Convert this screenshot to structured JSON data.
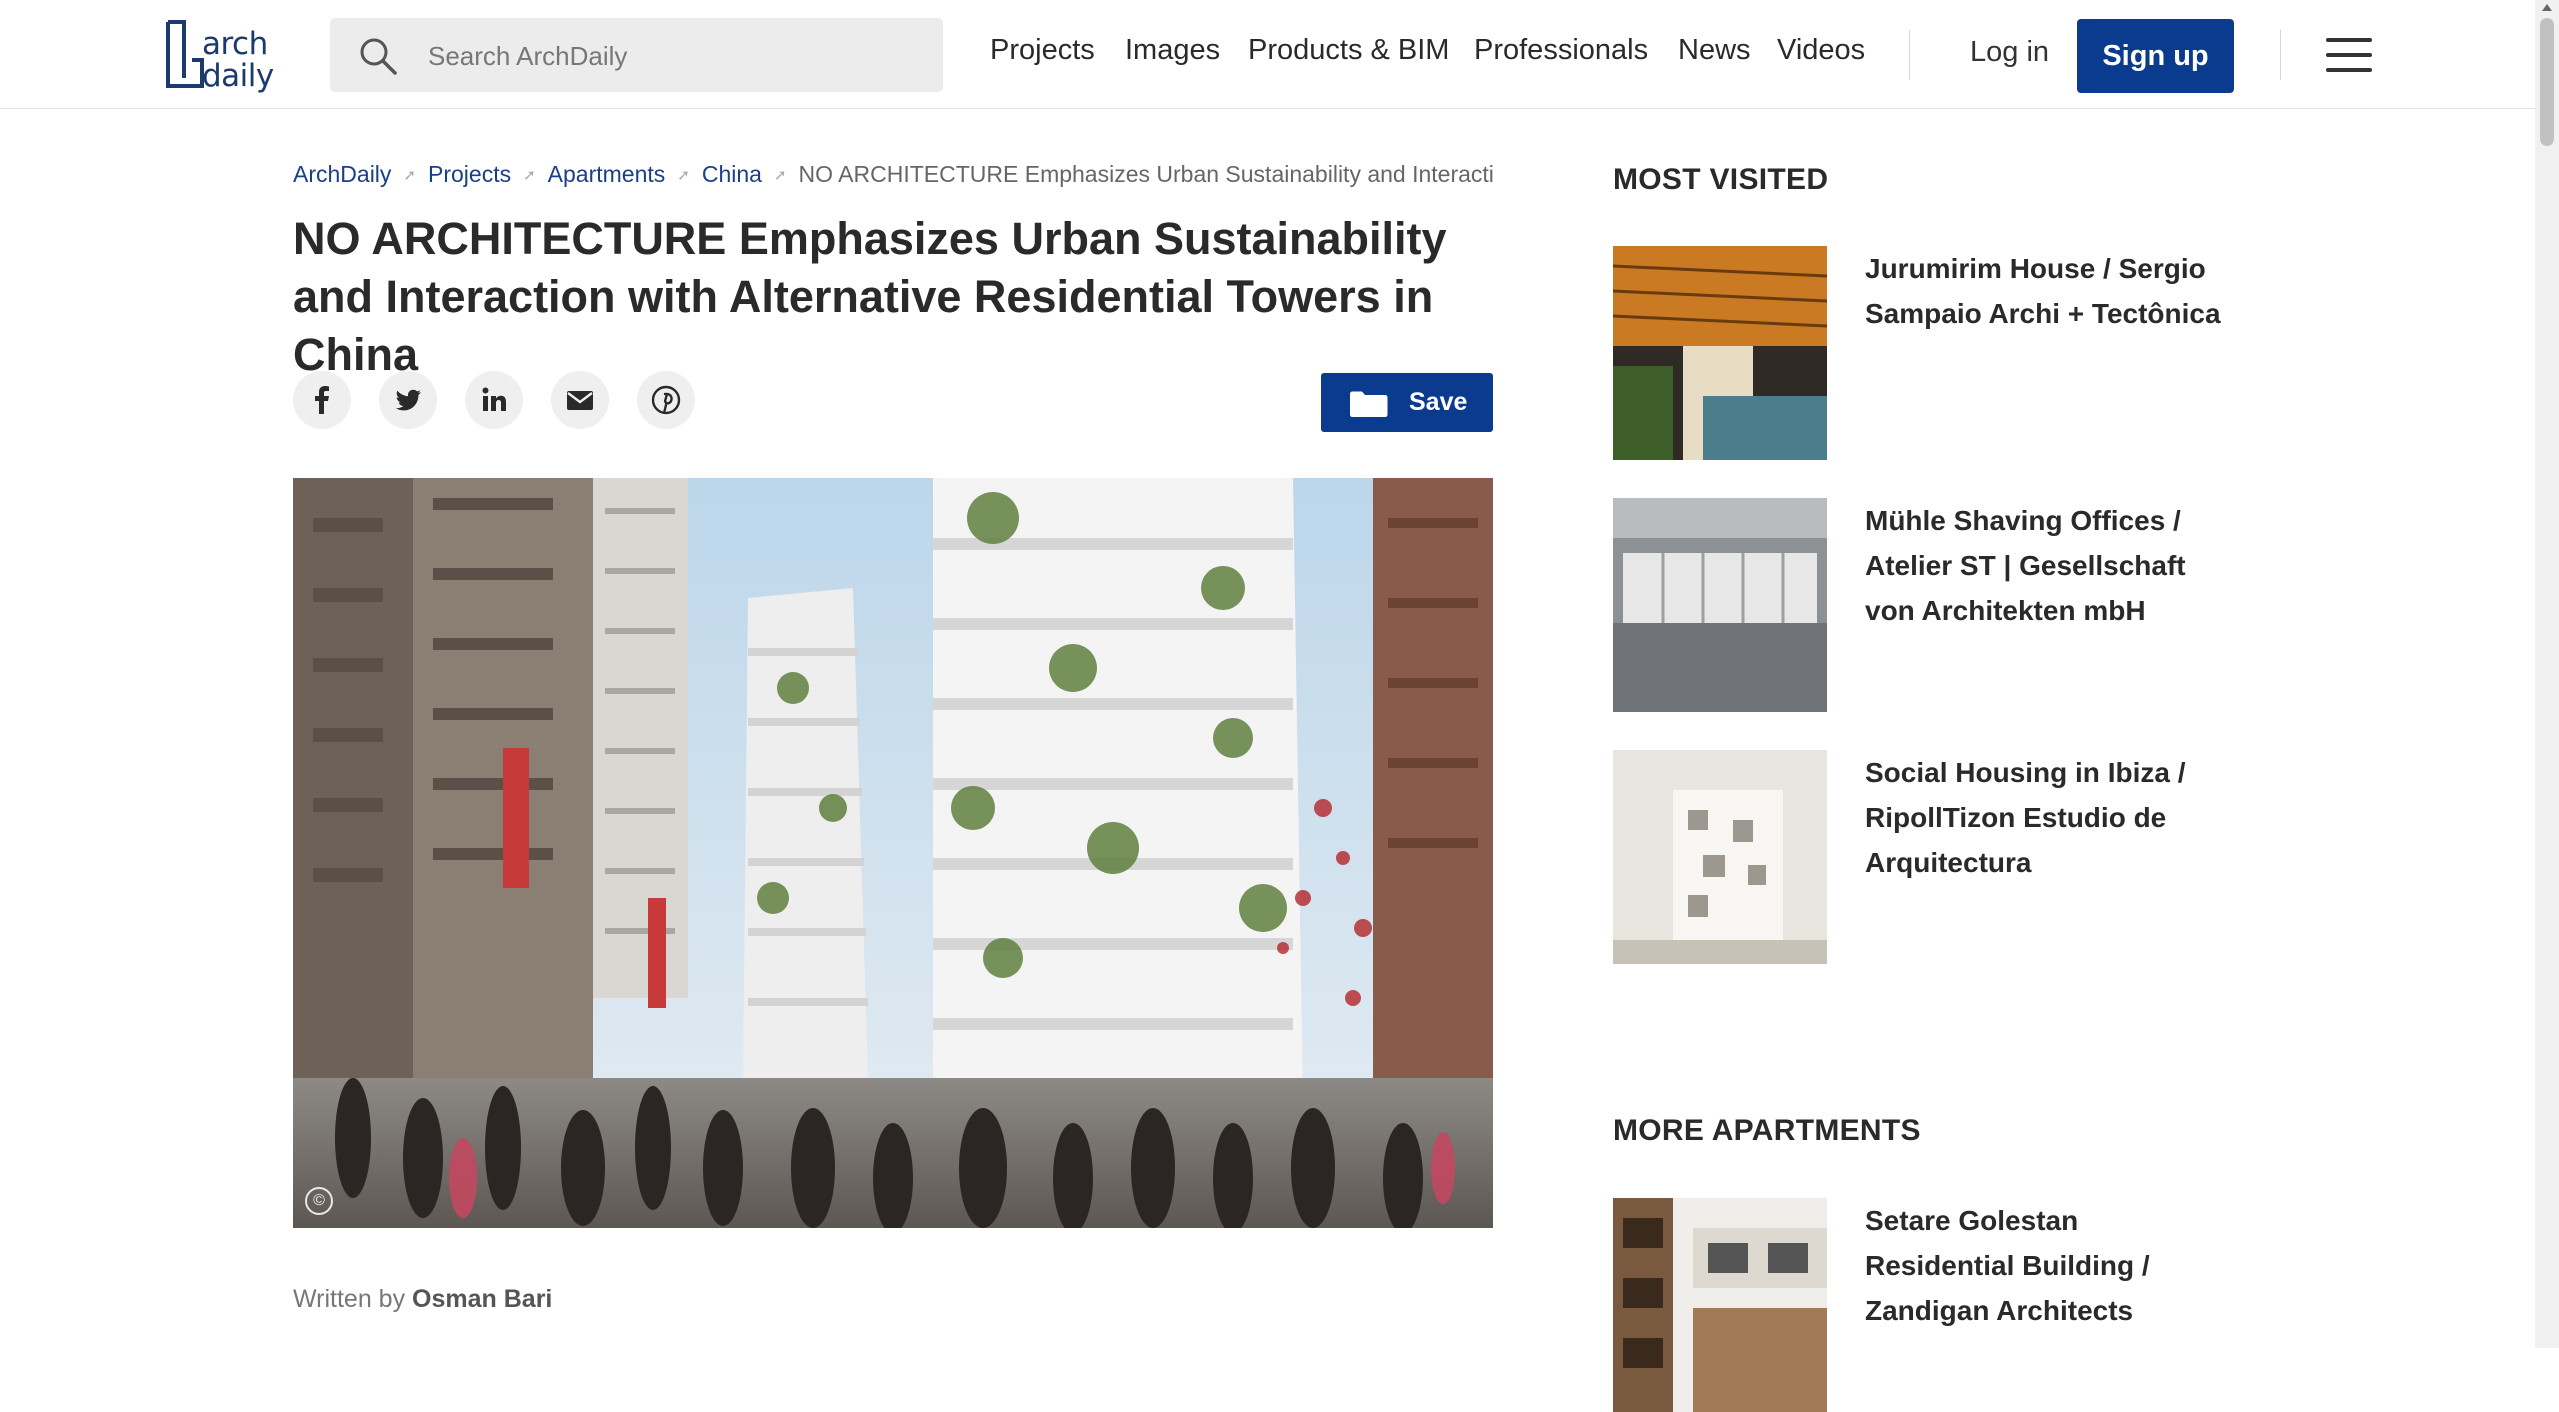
{
  "header": {
    "logo_line1": "arch",
    "logo_line2": "daily",
    "search_placeholder": "Search ArchDaily",
    "nav": [
      "Projects",
      "Images",
      "Products & BIM",
      "Professionals",
      "News",
      "Videos"
    ],
    "login": "Log in",
    "signup": "Sign up"
  },
  "breadcrumb": [
    "ArchDaily",
    "Projects",
    "Apartments",
    "China"
  ],
  "breadcrumb_current": "NO ARCHITECTURE Emphasizes Urban Sustainability and Interaction",
  "article": {
    "title": "NO ARCHITECTURE Emphasizes Urban Sustainability and Interaction with Alternative Residential Towers in China",
    "save_label": "Save",
    "share_icons": [
      "facebook-icon",
      "twitter-icon",
      "linkedin-icon",
      "email-icon",
      "pinterest-icon"
    ],
    "image_copyright_symbol": "©",
    "written_by_label": "Written by",
    "author": "Osman Bari"
  },
  "sidebar": {
    "most_visited_heading": "MOST VISITED",
    "most_visited": [
      "Jurumirim House / Sergio Sampaio Archi + Tectônica",
      "Mühle Shaving Offices / Atelier ST | Gesellschaft von Architekten mbH",
      "Social Housing in Ibiza / RipollTizon Estudio de Arquitectura"
    ],
    "more_apartments_heading": "MORE APARTMENTS",
    "more_apartments": [
      "Setare Golestan Residential Building / Zandigan Architects"
    ]
  },
  "colors": {
    "brand_blue": "#0b3b8f",
    "link_blue": "#1b3f86",
    "logo_blue": "#1c3a6e"
  }
}
